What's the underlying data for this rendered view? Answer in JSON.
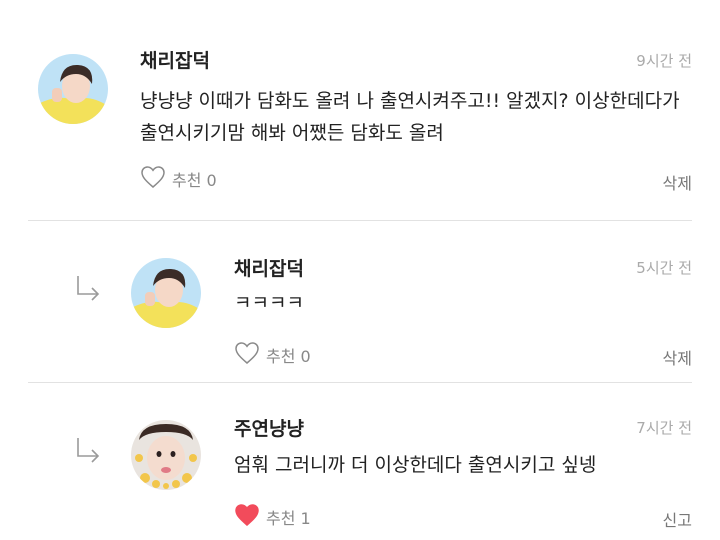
{
  "comments": [
    {
      "author": "채리잡덕",
      "time": "9시간 전",
      "text_line1": "냥냥냥 이때가 담화도 올려 나 출연시켜주고!! 알겠지? 이상한데다가",
      "text_line2": "출연시키기맘 해봐 어쨌든 담화도 올려",
      "like_label": "추천 0",
      "like_count": 0,
      "liked": false,
      "action_label": "삭제"
    },
    {
      "author": "채리잡덕",
      "time": "5시간 전",
      "text": "ㅋㅋㅋㅋ",
      "like_label": "추천 0",
      "like_count": 0,
      "liked": false,
      "action_label": "삭제",
      "is_reply": true
    },
    {
      "author": "주연냥냥",
      "time": "7시간 전",
      "text": "엄훠 그러니까 더 이상한데다 출연시키고 싶넹",
      "like_label": "추천 1",
      "like_count": 1,
      "liked": true,
      "action_label": "신고",
      "is_reply": true
    }
  ],
  "colors": {
    "liked_heart": "#f24b5b",
    "divider": "#e2e2e2",
    "timestamp": "#aaaaaa"
  },
  "icons": {
    "like_outline": "heart-outline-icon",
    "like_filled": "heart-filled-icon",
    "reply": "reply-arrow-icon"
  }
}
